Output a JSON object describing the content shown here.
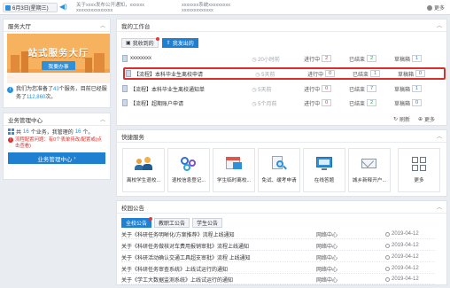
{
  "topbar": {
    "date": "6月3日(星期三)",
    "notices": [
      "关于xxxx发布公开通知，xxxxxx",
      "xxxxxxxxxxxxxxx",
      "xxxxxxx系统xxxxxxxxx",
      "xxxxxxxxxxxxx"
    ],
    "more": "更多"
  },
  "service_hall": {
    "title": "服务大厅",
    "banner_title": "站式服务大厅",
    "banner_button": "我要办事",
    "info_prefix": "我们为您准备了",
    "service_count": "43",
    "info_mid": "个服务，目前已经服务了",
    "served_count": "112,860",
    "info_suffix": "次。"
  },
  "business": {
    "title": "业务管理中心",
    "line_prefix": "共",
    "total": "16",
    "line_mid": "个业务，我管理的",
    "managed": "16",
    "line_suffix": "个。",
    "warning": "流程配置问题：有0个表单待改/配置或(点击查看)",
    "button": "业务管理中心"
  },
  "workbench": {
    "title": "我的工作台",
    "tabs": [
      "我收到的",
      "我发出的"
    ],
    "rows": [
      {
        "title": "xxxxxxxx",
        "time": "20小时前",
        "in_progress_label": "进行中",
        "in_progress": "2",
        "done_label": "已结束",
        "done": "2",
        "archived_label": "草稿箱",
        "archived": "1",
        "highlight": false
      },
      {
        "title": "【流程】本科毕业生离校申请",
        "time": "5天前",
        "in_progress_label": "进行中",
        "in_progress": "0",
        "done_label": "已结束",
        "done": "1",
        "archived_label": "草稿箱",
        "archived": "0",
        "highlight": true
      },
      {
        "title": "【流程】本科毕业生离校通知单",
        "time": "5天前",
        "in_progress_label": "进行中",
        "in_progress": "0",
        "done_label": "已结束",
        "done": "7",
        "archived_label": "草稿箱",
        "archived": "1",
        "highlight": false
      },
      {
        "title": "【流程】超期账户申请",
        "time": "5个月前",
        "in_progress_label": "进行中",
        "in_progress": "0",
        "done_label": "已结束",
        "done": "2",
        "archived_label": "草稿箱",
        "archived": "0",
        "highlight": false
      }
    ],
    "refresh": "刷新",
    "more": "更多"
  },
  "quick_services": {
    "title": "快捷服务",
    "items": [
      {
        "label": "离校学生退校...",
        "icon": "people-icon"
      },
      {
        "label": "退校信息登记...",
        "icon": "gears-icon"
      },
      {
        "label": "学生临时离校...",
        "icon": "calendar-icon"
      },
      {
        "label": "免试、缓考申请",
        "icon": "magnifier-doc-icon"
      },
      {
        "label": "在线答题",
        "icon": "monitor-icon"
      },
      {
        "label": "城乡新释开户...",
        "icon": "mail-icon"
      },
      {
        "label": "更多",
        "icon": "grid-icon"
      }
    ]
  },
  "announcements": {
    "title": "校园公告",
    "tabs": [
      "全校公告",
      "教职工公告",
      "学生公告"
    ],
    "rows": [
      {
        "title": "关于《科研任务明晰化/方案推荐》流程上线通知",
        "source": "网络中心",
        "date": "2019-04-12"
      },
      {
        "title": "关于《科研任务做核对车费用报销审批》流程上线通知",
        "source": "网络中心",
        "date": "2019-04-12"
      },
      {
        "title": "关于《科研活动确认交通工具超支审批》流程 上线通知",
        "source": "网络中心",
        "date": "2019-04-12"
      },
      {
        "title": "关于《科研任务审查系统》上线试运行的通知",
        "source": "网络中心",
        "date": "2019-04-12"
      },
      {
        "title": "关于《学工大数据监测系统》上线试运行的通知",
        "source": "网络中心",
        "date": "2019-04-12"
      }
    ]
  }
}
